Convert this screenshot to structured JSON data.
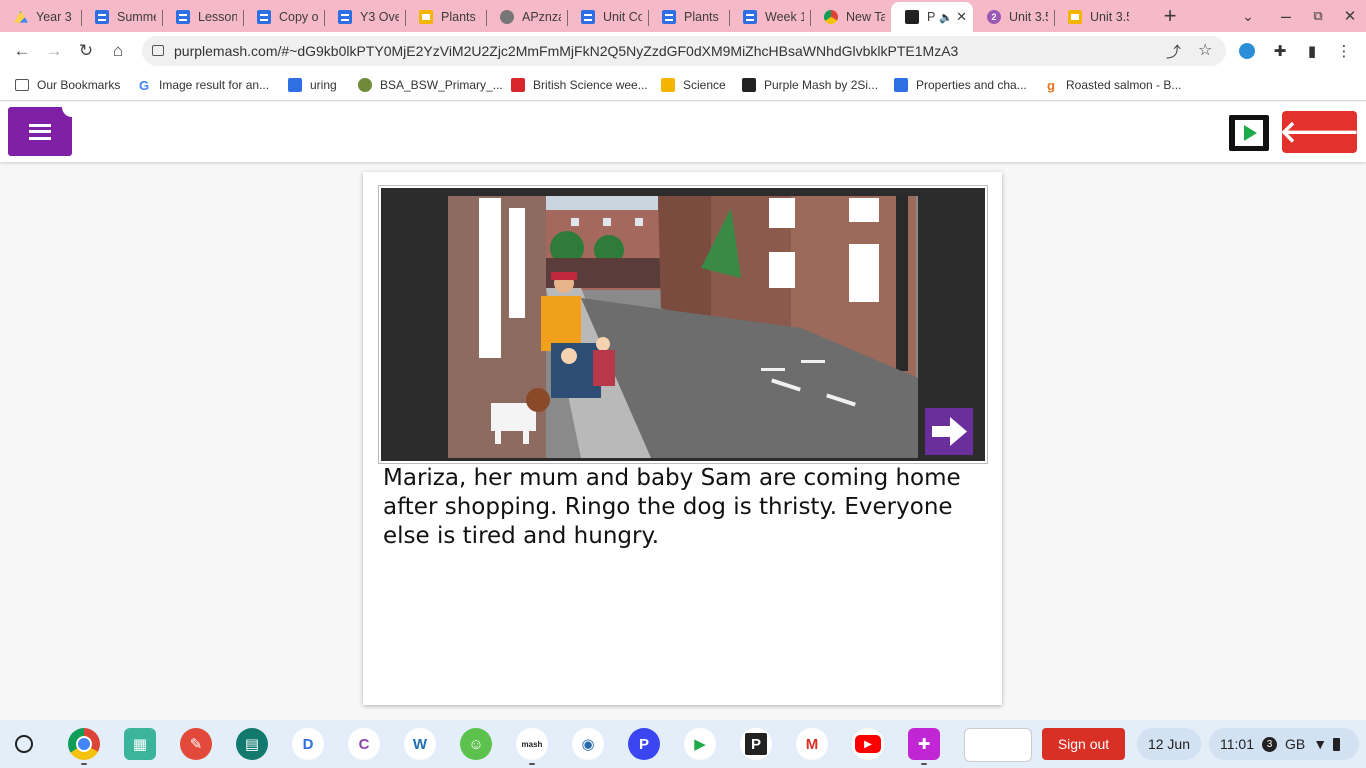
{
  "tabs": [
    {
      "label": "Year 3 -",
      "icon": "drive"
    },
    {
      "label": "Summe",
      "icon": "doc"
    },
    {
      "label": "Lesson",
      "icon": "doc"
    },
    {
      "label": "Copy of",
      "icon": "doc"
    },
    {
      "label": "Y3 Over",
      "icon": "doc"
    },
    {
      "label": "Plants -",
      "icon": "slides"
    },
    {
      "label": "APznza",
      "icon": "globe"
    },
    {
      "label": "Unit Co",
      "icon": "doc"
    },
    {
      "label": "Plants I",
      "icon": "doc"
    },
    {
      "label": "Week 1",
      "icon": "doc"
    },
    {
      "label": "New Ta",
      "icon": "chrome"
    },
    {
      "label": "P",
      "icon": "mash",
      "active": true,
      "audio": "🔈"
    },
    {
      "label": "Unit 3.5",
      "icon": "num",
      "badge": "2"
    },
    {
      "label": "Unit 3.5",
      "icon": "slides"
    }
  ],
  "toolbar": {
    "url": "purplemash.com/#~dG9kb0lkPTY0MjE2YzViM2U2Zjc2MmFmMjFkN2Q5NyZzdGF0dXM9MiZhcHBsaWNhdGlvbklkPTE1MzA3"
  },
  "bookmarks": [
    {
      "label": "Our Bookmarks",
      "icon": "folder"
    },
    {
      "label": "Image result for an...",
      "icon": "G"
    },
    {
      "label": "uring",
      "icon": "doc"
    },
    {
      "label": "BSA_BSW_Primary_...",
      "icon": "star"
    },
    {
      "label": "British Science wee...",
      "icon": "red"
    },
    {
      "label": "Science",
      "icon": "slides"
    },
    {
      "label": "Purple Mash by 2Si...",
      "icon": "mash"
    },
    {
      "label": "Properties and cha...",
      "icon": "doc"
    },
    {
      "label": "Roasted salmon - B...",
      "icon": "gf"
    }
  ],
  "story": {
    "text": "Mariza, her mum and baby Sam are coming home after shopping. Ringo the dog is thristy. Everyone else is tired and hungry."
  },
  "shelf": {
    "sign_out": "Sign out",
    "date": "12 Jun",
    "time": "11:01",
    "notifications": "3",
    "region": "GB"
  },
  "colors": {
    "tab_strip": "#f6b9c8",
    "purple": "#7f1fa6",
    "back_red": "#e2322b"
  }
}
